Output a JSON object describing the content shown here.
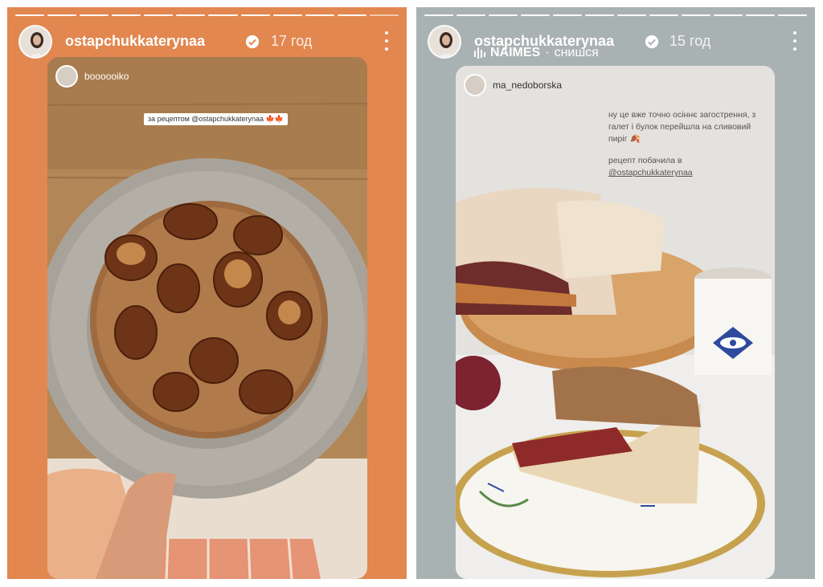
{
  "left_story": {
    "progress_segments": 12,
    "progress_done": 11,
    "username": "ostapchukkaterynaa",
    "time": "17 год",
    "verified_icon": "verified-badge-icon",
    "reposted": {
      "username": "boooooiko",
      "tag_text": "за рецептом @ostapchukkaterynaa 🍁🍁"
    }
  },
  "right_story": {
    "progress_segments": 12,
    "progress_done": 12,
    "username": "ostapchukkaterynaa",
    "time": "15 год",
    "verified_icon": "verified-badge-icon",
    "music": {
      "artist": "NAIMES",
      "separator": "·",
      "track": "снишся"
    },
    "reposted": {
      "username": "ma_nedoborska",
      "caption_line1": "ну це вже точно осіннє загострення, з галет і булок перейшла на сливовий пиріг 🍂",
      "caption_line2": "рецепт побачила в",
      "mention": "@ostapchukkaterynaa"
    }
  },
  "colors": {
    "left_background": "#e2874f",
    "right_background": "#a9b2b2"
  }
}
